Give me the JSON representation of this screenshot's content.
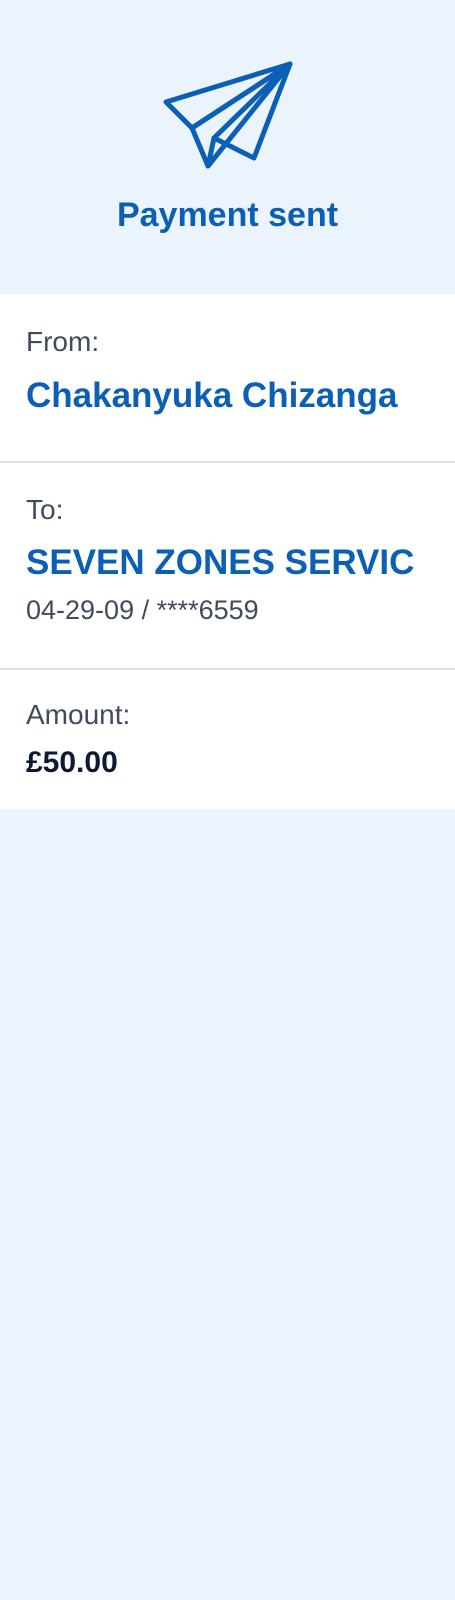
{
  "header": {
    "icon": "paper-plane-icon",
    "title": "Payment sent",
    "accent_color": "#0b5fb4"
  },
  "from": {
    "label": "From:",
    "name": "Chakanyuka Chizanga"
  },
  "to": {
    "label": "To:",
    "name": "SEVEN ZONES SERVIC",
    "account": "04-29-09 / ****6559"
  },
  "amount": {
    "label": "Amount:",
    "value": "£50.00"
  }
}
